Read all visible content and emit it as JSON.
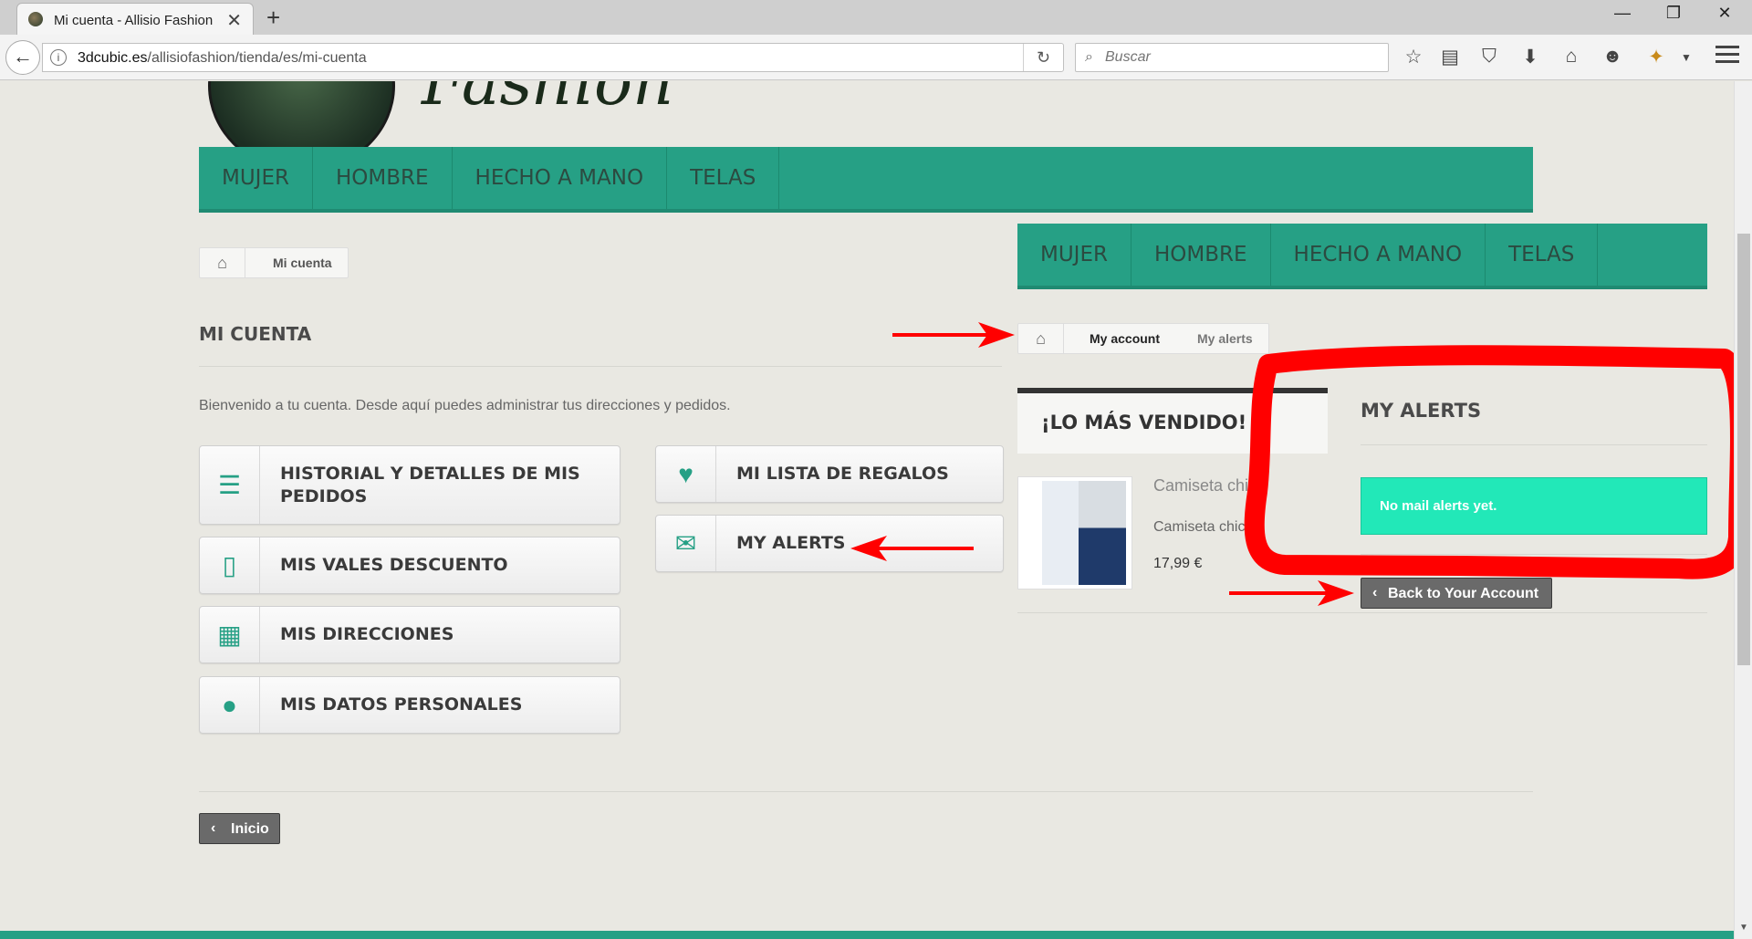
{
  "browser": {
    "tab_title": "Mi cuenta - Allisio Fashion",
    "tab_close": "✕",
    "new_tab": "+",
    "url_domain": "3dcubic.es",
    "url_path": "/allisiofashion/tienda/es/mi-cuenta",
    "search_placeholder": "Buscar",
    "minimize": "—",
    "restore": "❐",
    "close": "✕"
  },
  "site": {
    "logo_text": "Fashion",
    "menu": [
      "MUJER",
      "HOMBRE",
      "HECHO A MANO",
      "TELAS"
    ]
  },
  "breadcrumb": {
    "current": "Mi cuenta"
  },
  "page": {
    "title": "MI CUENTA",
    "welcome": "Bienvenido a tu cuenta. Desde aquí puedes administrar tus direcciones y pedidos."
  },
  "account_buttons": {
    "history": "HISTORIAL Y DETALLES DE MIS PEDIDOS",
    "vouchers": "MIS VALES DESCUENTO",
    "addresses": "MIS DIRECCIONES",
    "personal": "MIS DATOS PERSONALES",
    "wishlist": "MI LISTA DE REGALOS",
    "alerts": "MY ALERTS"
  },
  "home_button": "Inicio",
  "inset": {
    "menu": [
      "MUJER",
      "HOMBRE",
      "HECHO A MANO",
      "TELAS"
    ],
    "breadcrumb": [
      "My account",
      "My alerts"
    ],
    "bestsellers_title": "¡LO MÁS VENDIDO!",
    "product": {
      "title": "Camiseta chi",
      "desc": "Camiseta chico",
      "price": "17,99 €"
    },
    "alerts_title": "MY ALERTS",
    "alerts_message": "No mail alerts yet.",
    "back_button": "Back to Your Account"
  },
  "colors": {
    "brand_green": "#26a085",
    "alert_cyan": "#22e8b8",
    "annotation_red": "#ff0000"
  }
}
